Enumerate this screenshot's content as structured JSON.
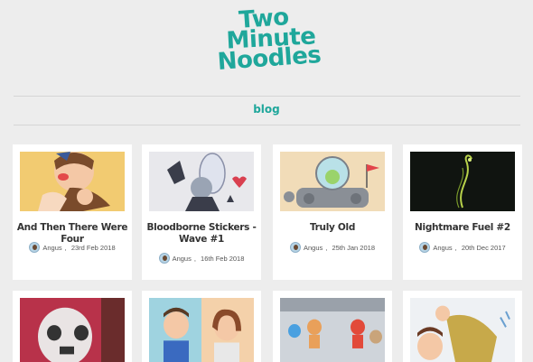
{
  "site": {
    "logo_line1": "Two",
    "logo_line2": "Minute",
    "logo_line3": "Noodles",
    "nav_blog": "blog"
  },
  "posts": [
    {
      "title": "And Then There Were Four",
      "author": "Angus",
      "date": "23rd Feb 2018"
    },
    {
      "title": "Bloodborne Stickers - Wave #1",
      "author": "Angus",
      "date": "16th Feb 2018"
    },
    {
      "title": "Truly Old",
      "author": "Angus",
      "date": "25th Jan 2018"
    },
    {
      "title": "Nightmare Fuel #2",
      "author": "Angus",
      "date": "20th Dec 2017"
    }
  ],
  "colors": {
    "accent": "#1fa79b",
    "background": "#ededed",
    "card": "#ffffff"
  }
}
